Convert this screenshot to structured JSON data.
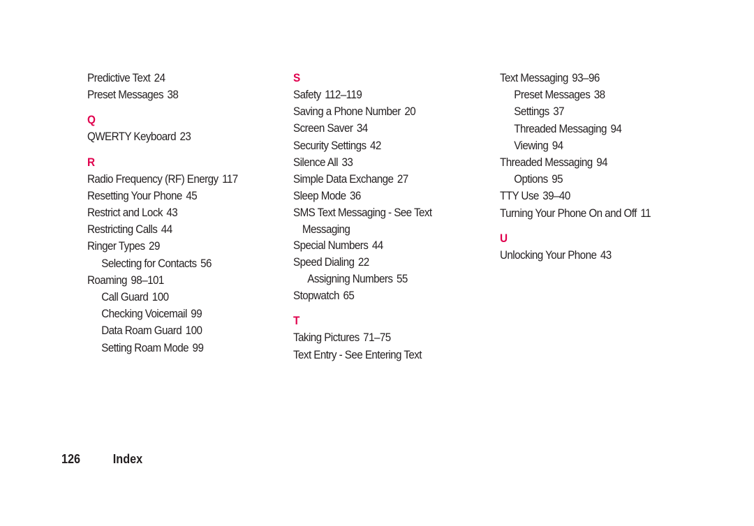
{
  "page": {
    "accent_color": "#e0004d",
    "footer": {
      "page_number": "126",
      "section": "Index"
    }
  },
  "columns": [
    {
      "items": [
        {
          "type": "entry",
          "text": "Predictive Text",
          "pages": "24"
        },
        {
          "type": "entry",
          "text": "Preset Messages",
          "pages": "38"
        },
        {
          "type": "letter",
          "text": "Q"
        },
        {
          "type": "entry",
          "text": "QWERTY Keyboard",
          "pages": "23"
        },
        {
          "type": "letter",
          "text": "R"
        },
        {
          "type": "entry",
          "text": "Radio Frequency (RF) Energy",
          "pages": "117"
        },
        {
          "type": "entry",
          "text": "Resetting Your Phone",
          "pages": "45"
        },
        {
          "type": "entry",
          "text": "Restrict and Lock",
          "pages": "43"
        },
        {
          "type": "entry",
          "text": "Restricting Calls",
          "pages": "44"
        },
        {
          "type": "entry",
          "text": "Ringer Types",
          "pages": "29"
        },
        {
          "type": "sub",
          "text": "Selecting for Contacts",
          "pages": "56"
        },
        {
          "type": "entry",
          "text": "Roaming",
          "pages": "98–101"
        },
        {
          "type": "sub",
          "text": "Call Guard",
          "pages": "100"
        },
        {
          "type": "sub",
          "text": "Checking Voicemail",
          "pages": "99"
        },
        {
          "type": "sub",
          "text": "Data Roam Guard",
          "pages": "100"
        },
        {
          "type": "sub",
          "text": "Setting Roam Mode",
          "pages": "99"
        }
      ]
    },
    {
      "items": [
        {
          "type": "letter",
          "text": "S"
        },
        {
          "type": "entry",
          "text": "Safety",
          "pages": "112–119"
        },
        {
          "type": "entry",
          "text": "Saving a Phone Number",
          "pages": "20"
        },
        {
          "type": "entry",
          "text": "Screen Saver",
          "pages": "34"
        },
        {
          "type": "entry",
          "text": "Security Settings",
          "pages": "42"
        },
        {
          "type": "entry",
          "text": "Silence All",
          "pages": "33"
        },
        {
          "type": "entry",
          "text": "Simple Data Exchange",
          "pages": "27"
        },
        {
          "type": "entry",
          "text": "Sleep Mode",
          "pages": "36"
        },
        {
          "type": "entry",
          "text": "SMS Text Messaging - See Text",
          "wrap": "Messaging",
          "pages": ""
        },
        {
          "type": "entry",
          "text": "Special Numbers",
          "pages": "44"
        },
        {
          "type": "entry",
          "text": "Speed Dialing",
          "pages": "22"
        },
        {
          "type": "sub",
          "text": "Assigning Numbers",
          "pages": "55"
        },
        {
          "type": "entry",
          "text": "Stopwatch",
          "pages": "65"
        },
        {
          "type": "letter",
          "text": "T"
        },
        {
          "type": "entry",
          "text": "Taking Pictures",
          "pages": "71–75"
        },
        {
          "type": "entry",
          "text": "Text Entry - See Entering Text",
          "pages": ""
        }
      ]
    },
    {
      "items": [
        {
          "type": "entry",
          "text": "Text Messaging",
          "pages": "93–96"
        },
        {
          "type": "sub",
          "text": "Preset Messages",
          "pages": "38"
        },
        {
          "type": "sub",
          "text": "Settings",
          "pages": "37"
        },
        {
          "type": "sub",
          "text": "Threaded Messaging",
          "pages": "94"
        },
        {
          "type": "sub",
          "text": "Viewing",
          "pages": "94"
        },
        {
          "type": "entry",
          "text": "Threaded Messaging",
          "pages": "94"
        },
        {
          "type": "sub",
          "text": "Options",
          "pages": "95"
        },
        {
          "type": "entry",
          "text": "TTY Use",
          "pages": "39–40"
        },
        {
          "type": "entry",
          "text": "Turning Your Phone On and Off",
          "pages": "11"
        },
        {
          "type": "letter",
          "text": "U"
        },
        {
          "type": "entry",
          "text": "Unlocking Your Phone",
          "pages": "43"
        }
      ]
    }
  ]
}
